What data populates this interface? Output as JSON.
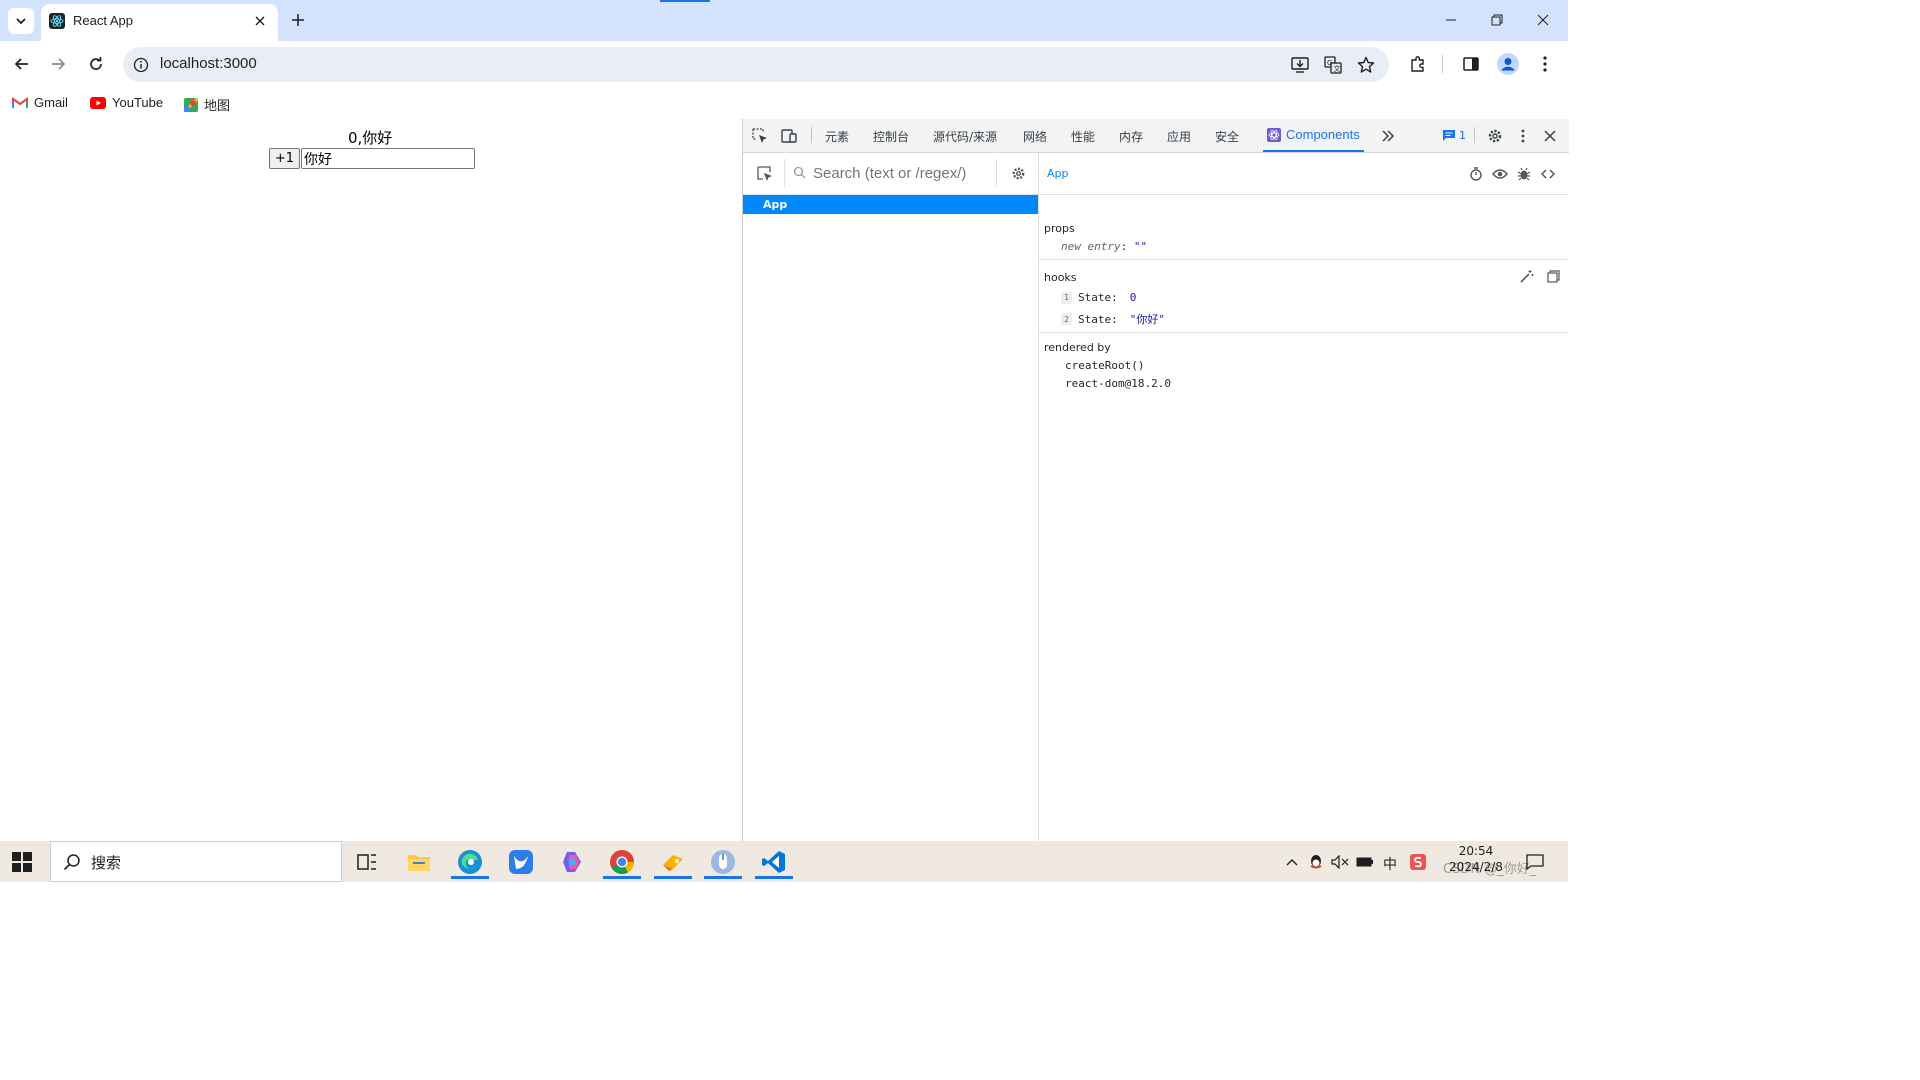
{
  "browser": {
    "tab": {
      "title": "React App",
      "favicon": "react-logo-icon"
    },
    "address": {
      "url": "localhost:3000"
    },
    "bookmarks": [
      {
        "label": "Gmail",
        "icon": "gmail-icon"
      },
      {
        "label": "YouTube",
        "icon": "youtube-icon"
      },
      {
        "label": "地图",
        "icon": "maps-icon"
      }
    ]
  },
  "page": {
    "display_text": "0,你好",
    "button_label": "+1",
    "input_value": "你好"
  },
  "devtools": {
    "tabs": [
      "元素",
      "控制台",
      "源代码/来源",
      "网络",
      "性能",
      "内存",
      "应用",
      "安全"
    ],
    "active_tab": "Components",
    "issues_count": "1",
    "search_placeholder": "Search (text or /regex/)",
    "tree": {
      "selected": "App"
    },
    "inspected": {
      "component": "App",
      "props_title": "props",
      "props": [
        {
          "key": "new entry",
          "value": "\"\""
        }
      ],
      "hooks_title": "hooks",
      "hooks": [
        {
          "index": "1",
          "name": "State:",
          "value": "0"
        },
        {
          "index": "2",
          "name": "State:",
          "value": "\"你好\""
        }
      ],
      "rendered_by_title": "rendered by",
      "rendered_by": [
        "createRoot()",
        "react-dom@18.2.0"
      ]
    }
  },
  "taskbar": {
    "search_label": "搜索",
    "time": "20:54",
    "date": "2024/2/8",
    "ime": "中",
    "watermark": "CSDN @_你好_"
  },
  "colors": {
    "accent": "#1a73e8",
    "react_selected": "#0088fa",
    "titlebar": "#d3e3fd"
  }
}
